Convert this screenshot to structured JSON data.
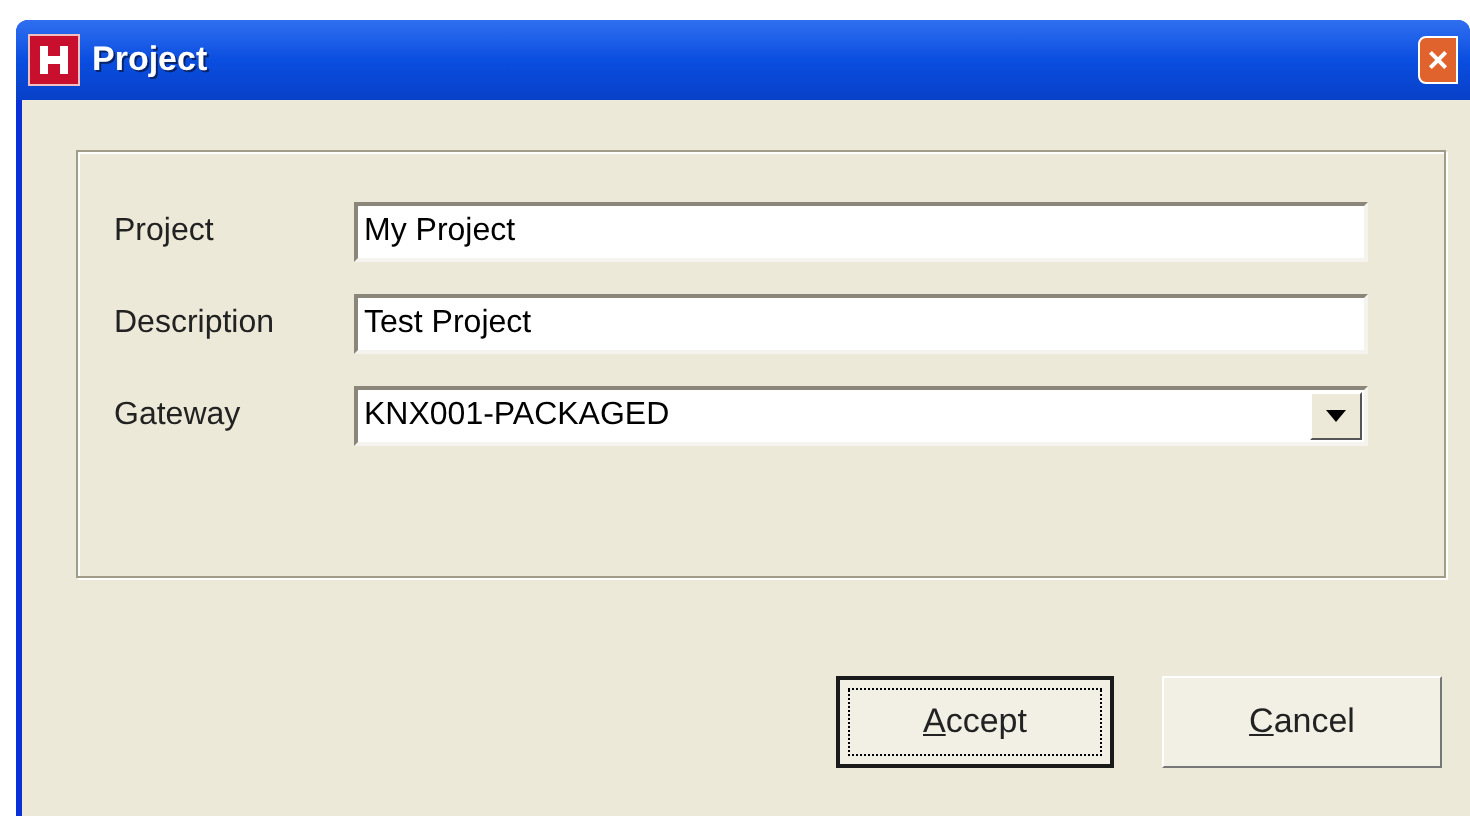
{
  "window": {
    "title": "Project",
    "close_button": "×"
  },
  "fields": [
    {
      "label": "Project",
      "kind": "text",
      "value": "My Project"
    },
    {
      "label": "Description",
      "kind": "text",
      "value": "Test Project"
    },
    {
      "label": "Gateway",
      "kind": "dropdown",
      "value": "KNX001-PACKAGED"
    }
  ],
  "buttons": [
    {
      "label": "Accept",
      "default": true,
      "underline_first": true
    },
    {
      "label": "Cancel",
      "default": false,
      "underline_first": true
    }
  ]
}
